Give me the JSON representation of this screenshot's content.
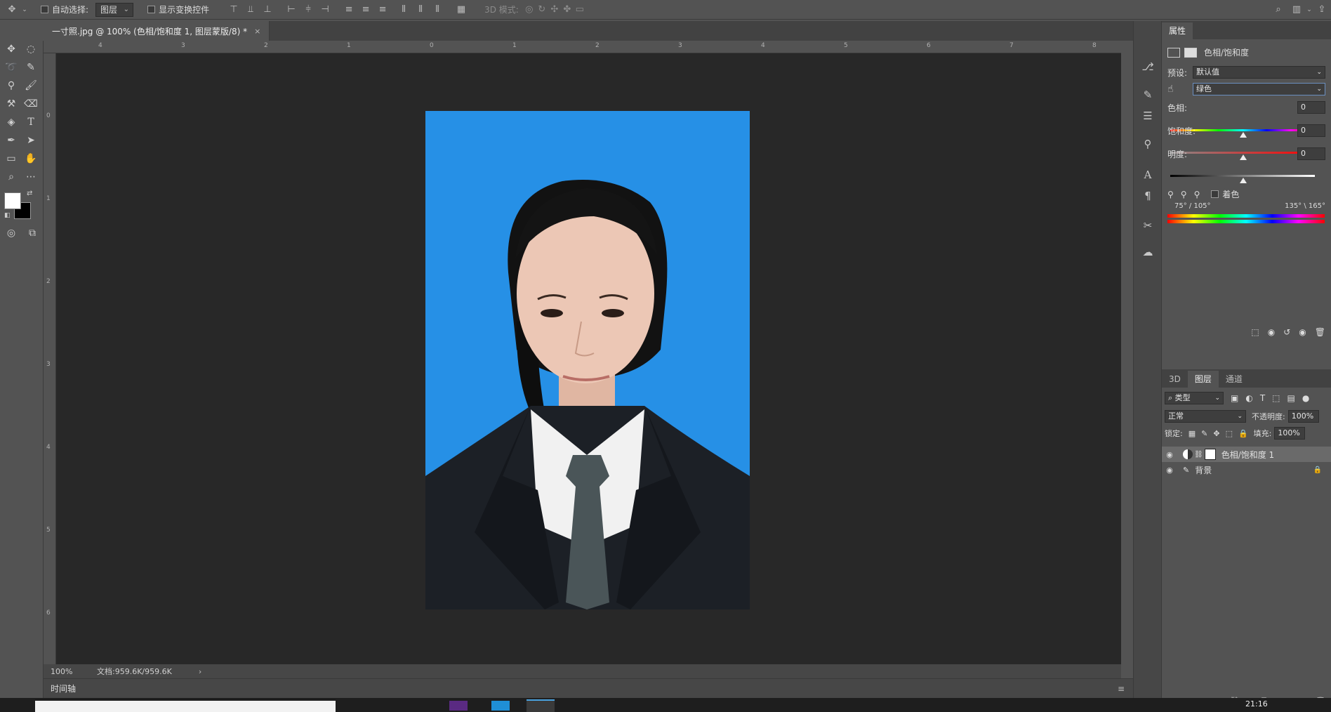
{
  "options_bar": {
    "auto_select_label": "自动选择:",
    "auto_select_value": "图层",
    "show_transform_label": "显示变换控件",
    "mode_3d_label": "3D 模式:"
  },
  "document": {
    "tab_title": "一寸照.jpg @ 100% (色相/饱和度 1, 图层蒙版/8) *",
    "zoom": "100%",
    "doc_size": "文档:959.6K/959.6K"
  },
  "ruler": {
    "h_labels": [
      "4",
      "3",
      "2",
      "1",
      "0",
      "1",
      "2",
      "3",
      "4",
      "5",
      "6",
      "7",
      "8"
    ],
    "v_labels": [
      "0",
      "1",
      "2",
      "3",
      "4",
      "5",
      "6"
    ]
  },
  "timeline_label": "时间轴",
  "properties": {
    "tab": "属性",
    "adjustment_title": "色相/饱和度",
    "preset_label": "预设:",
    "preset_value": "默认值",
    "channel_value": "绿色",
    "hue_label": "色相:",
    "hue_value": "0",
    "saturation_label": "饱和度:",
    "saturation_value": "0",
    "lightness_label": "明度:",
    "lightness_value": "0",
    "colorize_label": "着色",
    "range_left": "75° / 105°",
    "range_right": "135° \\ 165°"
  },
  "layers_panel": {
    "tabs": [
      "3D",
      "图层",
      "通道"
    ],
    "active_tab": "图层",
    "filter_value": "类型",
    "blend_mode": "正常",
    "opacity_label": "不透明度:",
    "opacity_value": "100%",
    "lock_label": "锁定:",
    "fill_label": "填充:",
    "fill_value": "100%",
    "layers": [
      {
        "name": "色相/饱和度 1"
      },
      {
        "name": "背景"
      }
    ]
  },
  "taskbar": {
    "clock": "21:16"
  },
  "colors": {
    "photo_background": "#2690e6",
    "canvas_background": "#282828",
    "panel_background": "#535353"
  }
}
